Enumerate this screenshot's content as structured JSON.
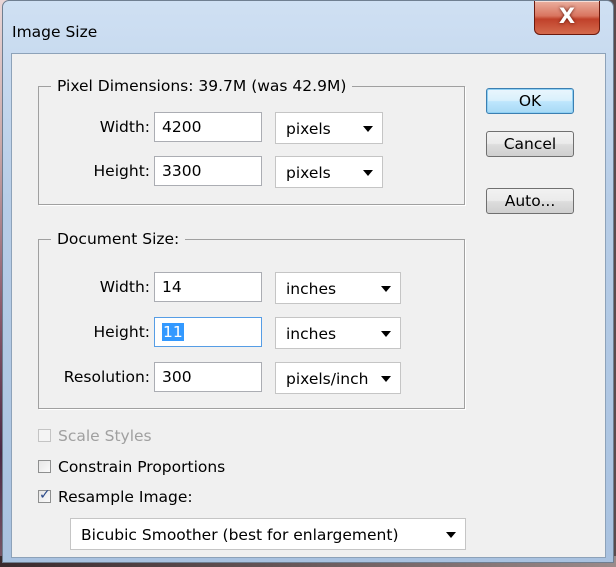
{
  "dialog": {
    "title": "Image Size",
    "close_glyph": "X"
  },
  "pixel_dimensions": {
    "legend": "Pixel Dimensions:  39.7M (was 42.9M)",
    "width_label": "Width:",
    "width_value": "4200",
    "width_unit": "pixels",
    "height_label": "Height:",
    "height_value": "3300",
    "height_unit": "pixels"
  },
  "document_size": {
    "legend": "Document Size:",
    "width_label": "Width:",
    "width_value": "14",
    "width_unit": "inches",
    "height_label": "Height:",
    "height_value": "11",
    "height_unit": "inches",
    "resolution_label": "Resolution:",
    "resolution_value": "300",
    "resolution_unit": "pixels/inch"
  },
  "buttons": {
    "ok": "OK",
    "cancel": "Cancel",
    "auto": "Auto..."
  },
  "options": {
    "scale_styles": {
      "label": "Scale Styles",
      "checked": false,
      "enabled": false
    },
    "constrain_proportions": {
      "label": "Constrain Proportions",
      "checked": false,
      "enabled": true
    },
    "resample_image": {
      "label": "Resample Image:",
      "checked": true,
      "enabled": true
    },
    "resample_method": "Bicubic Smoother (best for enlargement)"
  },
  "icons": {
    "dropdown_arrow": "chevron-down-icon",
    "close": "close-icon",
    "checkmark": "checkmark-icon"
  },
  "colors": {
    "title_bar": "#b7cde7",
    "close_button": "#c0412a",
    "dialog_face": "#f0f0f0",
    "selection": "#3399ff",
    "default_button_border": "#3c7fb1"
  }
}
